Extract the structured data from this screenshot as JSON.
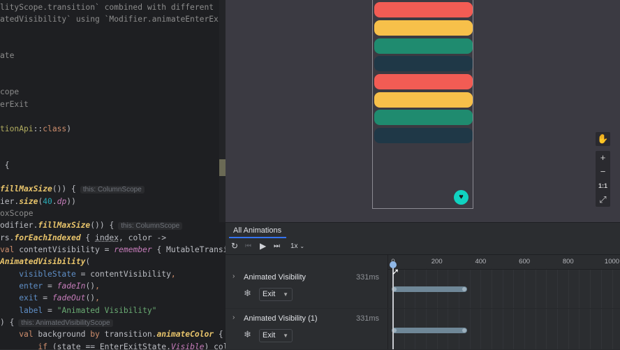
{
  "editor": {
    "lines": [
      {
        "i": 0,
        "t": [
          [
            "lityScope.transition` combined with different `Enter/",
            "cmt"
          ]
        ]
      },
      {
        "i": 1,
        "t": [
          [
            "atedVisibility` using `Modifier.animateEnterExit`.",
            "cmt"
          ]
        ]
      },
      {
        "i": 4,
        "t": [
          [
            "ate",
            "cmt"
          ]
        ]
      },
      {
        "i": 7,
        "t": [
          [
            "cope",
            "cmt"
          ]
        ]
      },
      {
        "i": 8,
        "t": [
          [
            "erExit",
            "cmt"
          ]
        ]
      },
      {
        "i": 10,
        "t": [
          [
            "tionApi",
            "ann"
          ],
          [
            "::",
            ""
          ],
          [
            "class",
            "kw"
          ],
          [
            ")",
            ""
          ]
        ]
      },
      {
        "i": 13,
        "t": [
          [
            " {",
            ""
          ]
        ]
      },
      {
        "i": 15,
        "t": [
          [
            "fillMaxSize",
            "fn"
          ],
          [
            "()) {",
            ""
          ]
        ],
        "hint": "this: ColumnScope"
      },
      {
        "i": 16,
        "t": [
          [
            "ier.",
            ""
          ],
          [
            "size",
            "fn"
          ],
          [
            "(",
            ""
          ],
          [
            "40",
            "num"
          ],
          [
            ".",
            ""
          ],
          [
            "dp",
            "it"
          ],
          [
            "))",
            ""
          ]
        ]
      },
      {
        "i": 17,
        "t": [
          [
            "oxScope",
            "cmt"
          ]
        ]
      },
      {
        "i": 18,
        "t": [
          [
            "odifier.",
            ""
          ],
          [
            "fillMaxSize",
            "fn"
          ],
          [
            "()) {",
            ""
          ]
        ],
        "hint": "this: ColumnScope"
      },
      {
        "i": 19,
        "t": [
          [
            "rs.",
            ""
          ],
          [
            "forEachIndexed",
            "fn"
          ],
          [
            " { ",
            ""
          ],
          [
            "index",
            "ul"
          ],
          [
            ", color ->",
            ""
          ]
        ]
      },
      {
        "i": 20,
        "t": [
          [
            "val",
            "kw"
          ],
          [
            " contentVisibility = ",
            ""
          ],
          [
            "remember",
            "it"
          ],
          [
            " { MutableTransitionS",
            ""
          ]
        ]
      },
      {
        "i": 21,
        "t": [
          [
            "AnimatedVisibility",
            "fn"
          ],
          [
            "(",
            ""
          ]
        ]
      },
      {
        "i": 22,
        "t": [
          [
            "    ",
            ""
          ],
          [
            "visibleState",
            "prm"
          ],
          [
            " = contentVisibility",
            ""
          ],
          [
            ",",
            "kw"
          ]
        ]
      },
      {
        "i": 23,
        "t": [
          [
            "    ",
            ""
          ],
          [
            "enter",
            "prm"
          ],
          [
            " = ",
            ""
          ],
          [
            "fadeIn",
            "it"
          ],
          [
            "()",
            ""
          ],
          [
            ",",
            "kw"
          ]
        ]
      },
      {
        "i": 24,
        "t": [
          [
            "    ",
            ""
          ],
          [
            "exit",
            "prm"
          ],
          [
            " = ",
            ""
          ],
          [
            "fadeOut",
            "it"
          ],
          [
            "()",
            ""
          ],
          [
            ",",
            "kw"
          ]
        ]
      },
      {
        "i": 25,
        "t": [
          [
            "    ",
            ""
          ],
          [
            "label",
            "prm"
          ],
          [
            " = ",
            ""
          ],
          [
            "\"Animated Visibility\"",
            "str"
          ]
        ]
      },
      {
        "i": 26,
        "t": [
          [
            ") {",
            ""
          ]
        ],
        "hint": "this: AnimatedVisibilityScope"
      },
      {
        "i": 27,
        "t": [
          [
            "    ",
            ""
          ],
          [
            "val",
            "kw"
          ],
          [
            " background ",
            ""
          ],
          [
            "by",
            "kw"
          ],
          [
            " transition.",
            ""
          ],
          [
            "animateColor",
            "fn"
          ],
          [
            " { state",
            ""
          ]
        ]
      },
      {
        "i": 28,
        "t": [
          [
            "        ",
            ""
          ],
          [
            "if",
            "kw"
          ],
          [
            " (state == EnterExitState.",
            ""
          ],
          [
            "Visible",
            "it"
          ],
          [
            ") color",
            ""
          ]
        ]
      }
    ]
  },
  "preview": {
    "bars": [
      "#f25c54",
      "#f7c04a",
      "#1f8b6f",
      "#1f3847",
      "#f25c54",
      "#f7c04a",
      "#1f8b6f",
      "#1f3847"
    ],
    "fab_icon": "heart-icon",
    "controls": {
      "pan": "✋",
      "zoom_in": "+",
      "zoom_out": "−",
      "actual_size": "1:1",
      "fit": "⤢"
    }
  },
  "panel": {
    "tab": "All Animations",
    "speed": "1x",
    "ticks": [
      "0",
      "200",
      "400",
      "600",
      "800",
      "1000"
    ],
    "tick_values": [
      0,
      200,
      400,
      600,
      800,
      1000
    ],
    "playhead_ms": 0,
    "accent": "#3574f0",
    "animations": [
      {
        "name": "Animated Visibility",
        "duration": "331ms",
        "duration_ms": 331,
        "state": "Exit"
      },
      {
        "name": "Animated Visibility (1)",
        "duration": "331ms",
        "duration_ms": 331,
        "state": "Exit"
      }
    ]
  }
}
